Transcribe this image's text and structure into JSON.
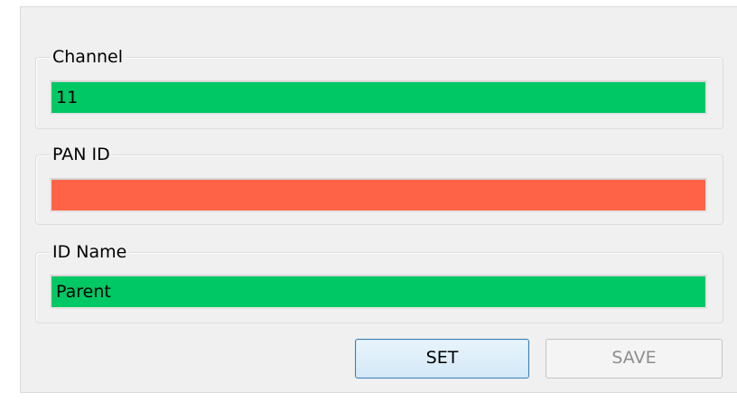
{
  "channel": {
    "legend": "Channel",
    "value": "11",
    "status_color": "#00c864"
  },
  "pan_id": {
    "legend": "PAN ID",
    "value": "",
    "status_color": "#ff6347"
  },
  "id_name": {
    "legend": "ID Name",
    "value": "Parent",
    "status_color": "#00c864"
  },
  "buttons": {
    "set_label": "SET",
    "save_label": "SAVE",
    "save_enabled": false
  }
}
